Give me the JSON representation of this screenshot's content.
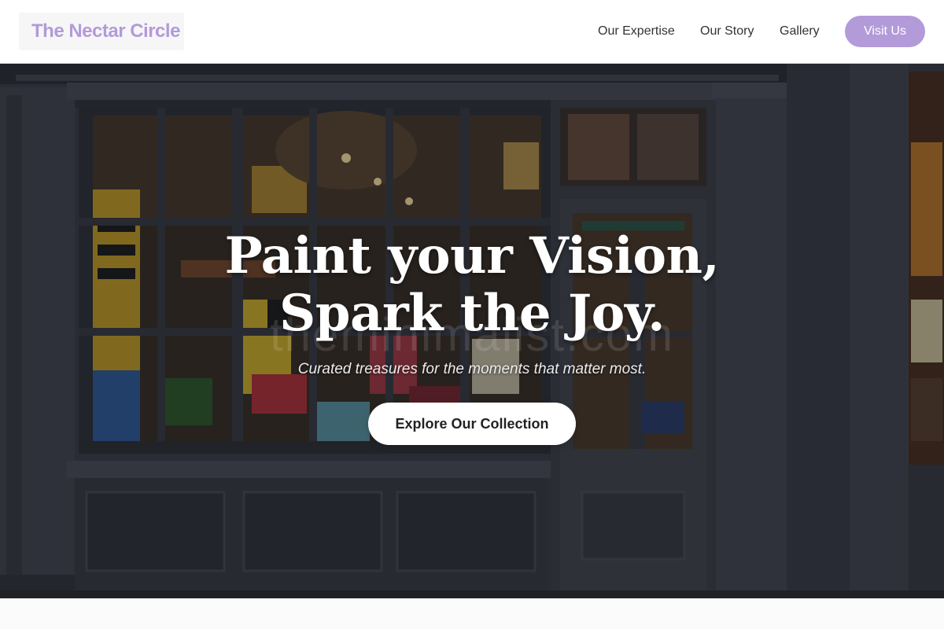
{
  "header": {
    "logo": "The Nectar Circle",
    "nav": [
      "Our Expertise",
      "Our Story",
      "Gallery"
    ],
    "visit_button": "Visit Us"
  },
  "hero": {
    "headline_line1": "Paint your Vision,",
    "headline_line2": "Spark the Joy.",
    "tagline": "Curated treasures for the moments that matter most.",
    "cta_button": "Explore Our Collection",
    "watermark": "theminimalist.com"
  },
  "colors": {
    "accent": "#b39ad9",
    "storefront": "#3b3e46",
    "header_bg": "#ffffff"
  }
}
